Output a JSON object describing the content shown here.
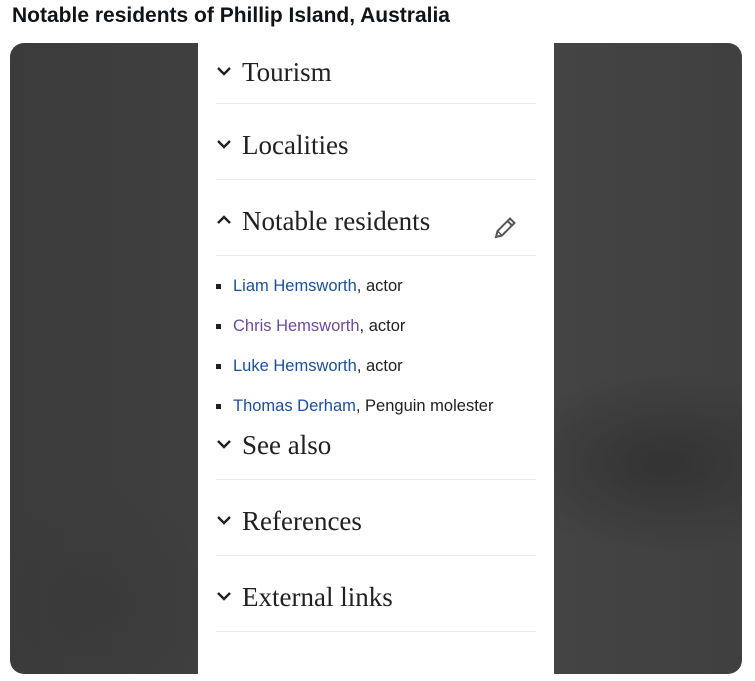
{
  "post": {
    "title": "Notable residents of Phillip Island, Australia"
  },
  "article": {
    "sections": [
      {
        "label": "Tourism",
        "state": "collapsed"
      },
      {
        "label": "Localities",
        "state": "collapsed"
      },
      {
        "label": "Notable residents",
        "state": "expanded"
      },
      {
        "label": "See also",
        "state": "collapsed"
      },
      {
        "label": "References",
        "state": "collapsed"
      },
      {
        "label": "External links",
        "state": "collapsed"
      }
    ],
    "residents": [
      {
        "name": "Liam Hemsworth",
        "desc": ", actor",
        "link_state": "unvisited"
      },
      {
        "name": "Chris Hemsworth",
        "desc": ", actor",
        "link_state": "visited"
      },
      {
        "name": "Luke Hemsworth",
        "desc": ", actor",
        "link_state": "unvisited"
      },
      {
        "name": "Thomas Derham",
        "desc": ", Penguin molester",
        "link_state": "unvisited"
      }
    ],
    "icons": {
      "collapsed": "chevron-down-icon",
      "expanded": "chevron-up-icon",
      "edit": "pencil-icon"
    }
  },
  "colors": {
    "link": "#1a4fa3",
    "visited_link": "#6b4ba1",
    "text": "#202122",
    "backdrop": "#424242"
  }
}
